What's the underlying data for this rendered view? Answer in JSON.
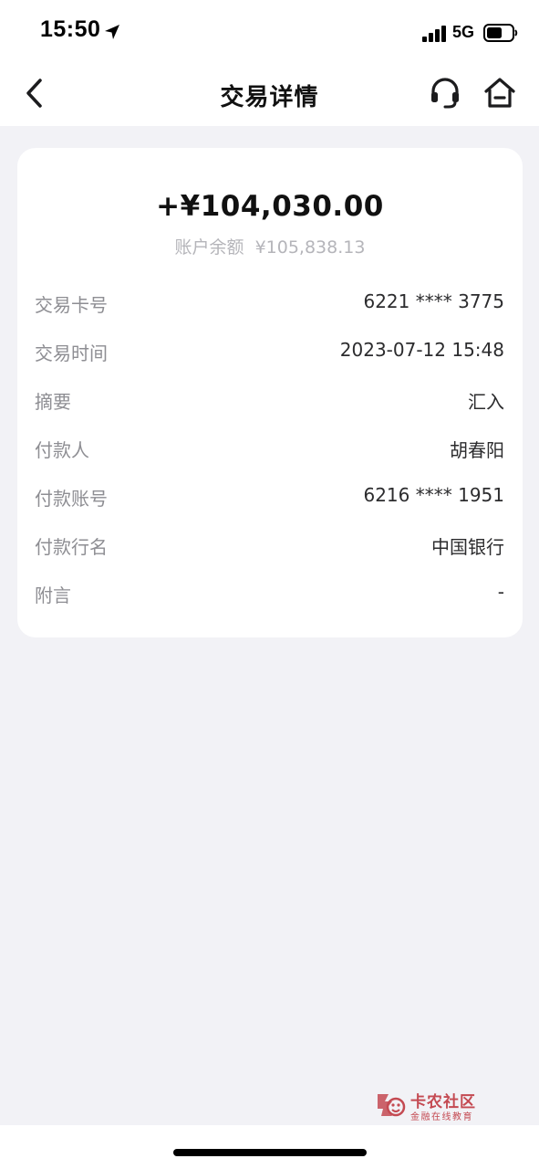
{
  "status_bar": {
    "time": "15:50",
    "network": "5G",
    "icons": [
      "location-arrow-icon",
      "cellular-signal-icon",
      "battery-icon"
    ]
  },
  "nav": {
    "title": "交易详情",
    "icons": [
      "chevron-left-icon",
      "headset-icon",
      "home-icon"
    ]
  },
  "transaction": {
    "amount": "+¥104,030.00",
    "balance_label": "账户余额",
    "balance_value": "¥105,838.13"
  },
  "details": [
    {
      "label": "交易卡号",
      "value": "6221 **** 3775"
    },
    {
      "label": "交易时间",
      "value": "2023-07-12 15:48"
    },
    {
      "label": "摘要",
      "value": "汇入"
    },
    {
      "label": "付款人",
      "value": "胡春阳"
    },
    {
      "label": "付款账号",
      "value": "6216 **** 1951"
    },
    {
      "label": "付款行名",
      "value": "中国银行"
    },
    {
      "label": "附言",
      "value": "-"
    }
  ],
  "watermark": {
    "title": "卡农社区",
    "subtitle": "金融在线教育"
  },
  "colors": {
    "background": "#f2f2f6",
    "card": "#ffffff",
    "label": "#8e8e93",
    "value": "#2c2c2e",
    "watermark": "#c44a52"
  }
}
